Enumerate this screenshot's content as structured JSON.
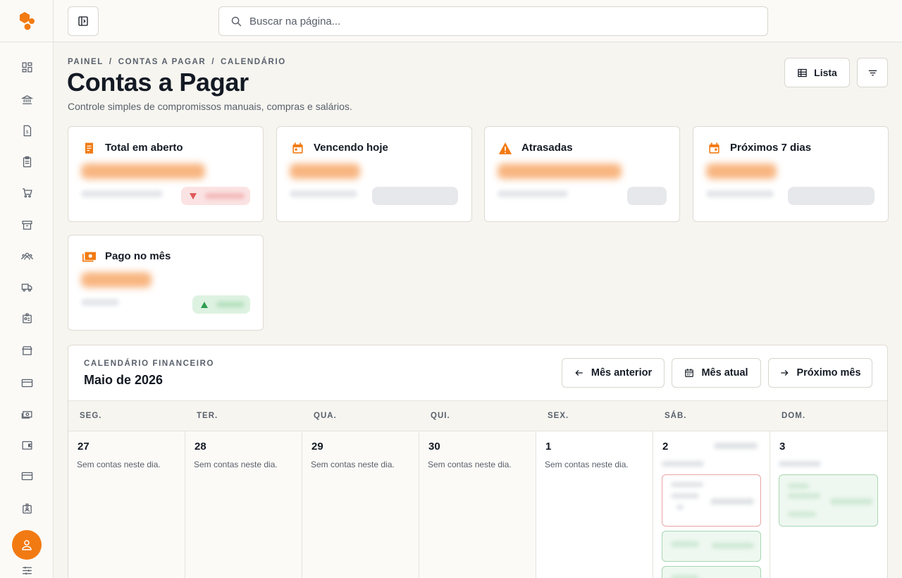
{
  "search": {
    "placeholder": "Buscar na página..."
  },
  "breadcrumb": [
    "PAINEL",
    "CONTAS A PAGAR",
    "CALENDÁRIO"
  ],
  "breadcrumb_sep": "/",
  "page": {
    "title": "Contas a Pagar",
    "subtitle": "Controle simples de compromissos manuais, compras e salários."
  },
  "header_buttons": {
    "list_label": "Lista"
  },
  "cards": [
    {
      "title": "Total em aberto",
      "icon": "receipt-icon",
      "trend": "down"
    },
    {
      "title": "Vencendo hoje",
      "icon": "calendar-today-icon"
    },
    {
      "title": "Atrasadas",
      "icon": "warning-icon"
    },
    {
      "title": "Próximos 7 dias",
      "icon": "calendar-week-icon"
    },
    {
      "title": "Pago no mês",
      "icon": "money-icon",
      "trend": "up"
    }
  ],
  "calendar": {
    "kicker": "CALENDÁRIO FINANCEIRO",
    "month": "Maio de 2026",
    "prev_label": "Mês anterior",
    "current_label": "Mês atual",
    "next_label": "Próximo mês",
    "weekdays": [
      "SEG.",
      "TER.",
      "QUA.",
      "QUI.",
      "SEX.",
      "SÁB.",
      "DOM."
    ],
    "days": [
      {
        "num": "27",
        "empty": "Sem contas neste dia."
      },
      {
        "num": "28",
        "empty": "Sem contas neste dia."
      },
      {
        "num": "29",
        "empty": "Sem contas neste dia."
      },
      {
        "num": "30",
        "empty": "Sem contas neste dia."
      },
      {
        "num": "1",
        "empty": "Sem contas neste dia."
      },
      {
        "num": "2",
        "empty": ""
      },
      {
        "num": "3",
        "empty": ""
      }
    ]
  },
  "colors": {
    "accent": "#f27a12",
    "danger": "#e05a5a",
    "success": "#2e9e4f"
  }
}
